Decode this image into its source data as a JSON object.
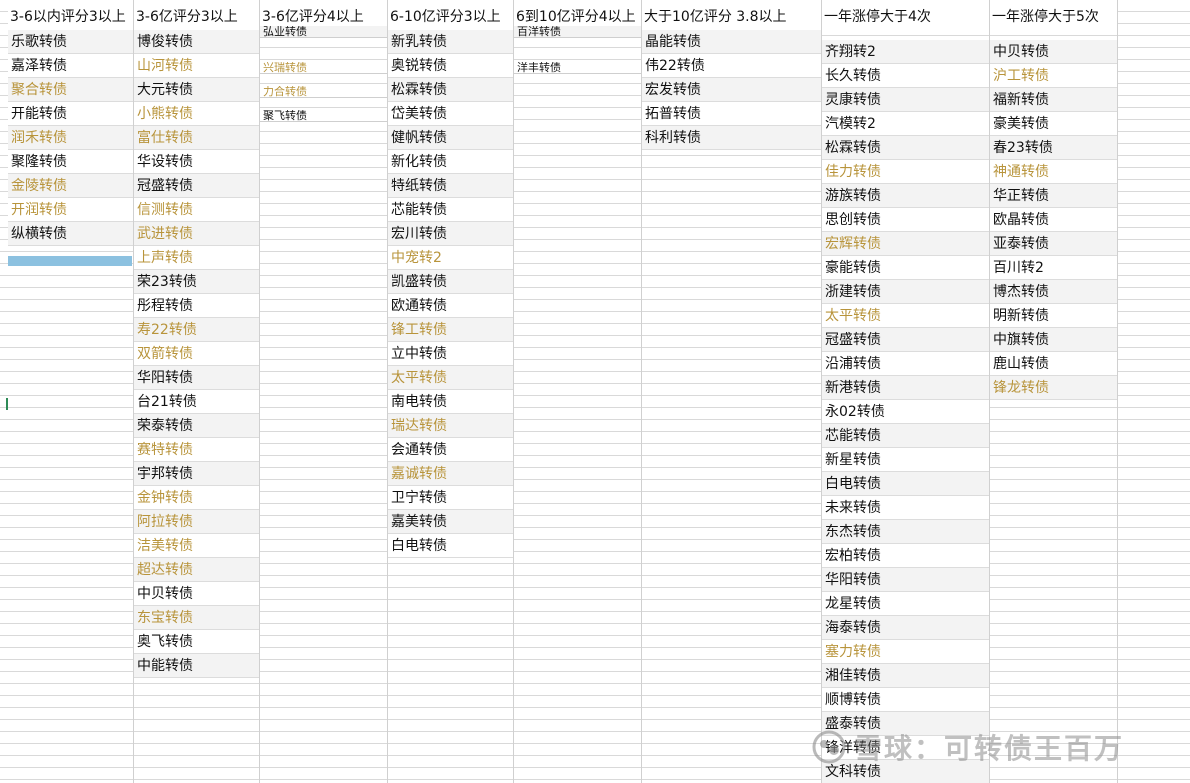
{
  "columns": [
    {
      "header": "3-6以内评分3以上",
      "rows": [
        {
          "text": "乐歌转债",
          "color": "black"
        },
        {
          "text": "嘉泽转债",
          "color": "black"
        },
        {
          "text": "聚合转债",
          "color": "gold"
        },
        {
          "text": "开能转债",
          "color": "black"
        },
        {
          "text": "润禾转债",
          "color": "gold"
        },
        {
          "text": "聚隆转债",
          "color": "black"
        },
        {
          "text": "金陵转债",
          "color": "gold"
        },
        {
          "text": "开润转债",
          "color": "gold"
        },
        {
          "text": "纵横转债",
          "color": "black"
        }
      ]
    },
    {
      "header": "3-6亿评分3以上",
      "rows": [
        {
          "text": "博俊转债",
          "color": "black"
        },
        {
          "text": "山河转债",
          "color": "gold"
        },
        {
          "text": "大元转债",
          "color": "black"
        },
        {
          "text": "小熊转债",
          "color": "gold"
        },
        {
          "text": "富仕转债",
          "color": "gold"
        },
        {
          "text": "华设转债",
          "color": "black"
        },
        {
          "text": "冠盛转债",
          "color": "black"
        },
        {
          "text": "信测转债",
          "color": "gold"
        },
        {
          "text": "武进转债",
          "color": "gold"
        },
        {
          "text": "上声转债",
          "color": "gold"
        },
        {
          "text": "荣23转债",
          "color": "black"
        },
        {
          "text": "彤程转债",
          "color": "black"
        },
        {
          "text": "寿22转债",
          "color": "gold"
        },
        {
          "text": "双箭转债",
          "color": "gold"
        },
        {
          "text": "华阳转债",
          "color": "black"
        },
        {
          "text": "台21转债",
          "color": "black"
        },
        {
          "text": "荣泰转债",
          "color": "black"
        },
        {
          "text": "赛特转债",
          "color": "gold"
        },
        {
          "text": "宇邦转债",
          "color": "black"
        },
        {
          "text": "金钟转债",
          "color": "gold"
        },
        {
          "text": "阿拉转债",
          "color": "gold"
        },
        {
          "text": "洁美转债",
          "color": "gold"
        },
        {
          "text": "超达转债",
          "color": "gold"
        },
        {
          "text": "中贝转债",
          "color": "black"
        },
        {
          "text": "东宝转债",
          "color": "gold"
        },
        {
          "text": "奥飞转债",
          "color": "black"
        },
        {
          "text": "中能转债",
          "color": "black"
        }
      ]
    },
    {
      "header": "3-6亿评分4以上",
      "small_rows": [
        {
          "text": "弘业转债",
          "color": "black"
        },
        {
          "text": "",
          "color": "black"
        },
        {
          "text": "",
          "color": "black"
        },
        {
          "text": "兴瑞转债",
          "color": "gold"
        },
        {
          "text": "",
          "color": "black"
        },
        {
          "text": "力合转债",
          "color": "gold"
        },
        {
          "text": "",
          "color": "black"
        },
        {
          "text": "聚飞转债",
          "color": "black"
        }
      ]
    },
    {
      "header": "6-10亿评分3以上",
      "rows": [
        {
          "text": "新乳转债",
          "color": "black"
        },
        {
          "text": "奥锐转债",
          "color": "black"
        },
        {
          "text": "松霖转债",
          "color": "black"
        },
        {
          "text": "岱美转债",
          "color": "black"
        },
        {
          "text": "健帆转债",
          "color": "black"
        },
        {
          "text": "新化转债",
          "color": "black"
        },
        {
          "text": "特纸转债",
          "color": "black"
        },
        {
          "text": "芯能转债",
          "color": "black"
        },
        {
          "text": "宏川转债",
          "color": "black"
        },
        {
          "text": "中宠转2",
          "color": "gold"
        },
        {
          "text": "凯盛转债",
          "color": "black"
        },
        {
          "text": "欧通转债",
          "color": "black"
        },
        {
          "text": "锋工转债",
          "color": "gold"
        },
        {
          "text": "立中转债",
          "color": "black"
        },
        {
          "text": "太平转债",
          "color": "gold"
        },
        {
          "text": "南电转债",
          "color": "black"
        },
        {
          "text": "瑞达转债",
          "color": "gold"
        },
        {
          "text": "会通转债",
          "color": "black"
        },
        {
          "text": "嘉诚转债",
          "color": "gold"
        },
        {
          "text": "卫宁转债",
          "color": "black"
        },
        {
          "text": "嘉美转债",
          "color": "black"
        },
        {
          "text": "白电转债",
          "color": "black"
        }
      ]
    },
    {
      "header": "6到10亿评分4以上",
      "small_rows": [
        {
          "text": "百洋转债",
          "color": "black"
        },
        {
          "text": "",
          "color": "black"
        },
        {
          "text": "",
          "color": "black"
        },
        {
          "text": "洋丰转债",
          "color": "black"
        }
      ]
    },
    {
      "header": "大于10亿评分 3.8以上",
      "rows": [
        {
          "text": "晶能转债",
          "color": "black"
        },
        {
          "text": "伟22转债",
          "color": "black"
        },
        {
          "text": "宏发转债",
          "color": "black"
        },
        {
          "text": "拓普转债",
          "color": "black"
        },
        {
          "text": "科利转债",
          "color": "black"
        }
      ]
    },
    {
      "header": "一年涨停大于4次",
      "rows": [
        {
          "text": "齐翔转2",
          "color": "black"
        },
        {
          "text": "长久转债",
          "color": "black"
        },
        {
          "text": "灵康转债",
          "color": "black"
        },
        {
          "text": "汽模转2",
          "color": "black"
        },
        {
          "text": "松霖转债",
          "color": "black"
        },
        {
          "text": "佳力转债",
          "color": "gold"
        },
        {
          "text": "游族转债",
          "color": "black"
        },
        {
          "text": "思创转债",
          "color": "black"
        },
        {
          "text": "宏辉转债",
          "color": "gold"
        },
        {
          "text": "豪能转债",
          "color": "black"
        },
        {
          "text": "浙建转债",
          "color": "black"
        },
        {
          "text": "太平转债",
          "color": "gold"
        },
        {
          "text": "冠盛转债",
          "color": "black"
        },
        {
          "text": "沿浦转债",
          "color": "black"
        },
        {
          "text": "新港转债",
          "color": "black"
        },
        {
          "text": "永02转债",
          "color": "black"
        },
        {
          "text": "芯能转债",
          "color": "black"
        },
        {
          "text": "新星转债",
          "color": "black"
        },
        {
          "text": "白电转债",
          "color": "black"
        },
        {
          "text": "未来转债",
          "color": "black"
        },
        {
          "text": "东杰转债",
          "color": "black"
        },
        {
          "text": "宏柏转债",
          "color": "black"
        },
        {
          "text": "华阳转债",
          "color": "black"
        },
        {
          "text": "龙星转债",
          "color": "black"
        },
        {
          "text": "海泰转债",
          "color": "black"
        },
        {
          "text": "塞力转债",
          "color": "gold"
        },
        {
          "text": "湘佳转债",
          "color": "black"
        },
        {
          "text": "顺博转债",
          "color": "black"
        },
        {
          "text": "盛泰转债",
          "color": "black"
        },
        {
          "text": "锋洋转债",
          "color": "black"
        },
        {
          "text": "文科转债",
          "color": "black"
        }
      ]
    },
    {
      "header": "一年涨停大于5次",
      "rows": [
        {
          "text": "中贝转债",
          "color": "black"
        },
        {
          "text": "沪工转债",
          "color": "gold"
        },
        {
          "text": "福新转债",
          "color": "black"
        },
        {
          "text": "豪美转债",
          "color": "black"
        },
        {
          "text": "春23转债",
          "color": "black"
        },
        {
          "text": "神通转债",
          "color": "gold"
        },
        {
          "text": "华正转债",
          "color": "black"
        },
        {
          "text": "欧晶转债",
          "color": "black"
        },
        {
          "text": "亚泰转债",
          "color": "black"
        },
        {
          "text": "百川转2",
          "color": "black"
        },
        {
          "text": "博杰转债",
          "color": "black"
        },
        {
          "text": "明新转债",
          "color": "black"
        },
        {
          "text": "中旗转债",
          "color": "black"
        },
        {
          "text": "鹿山转债",
          "color": "black"
        },
        {
          "text": "锋龙转债",
          "color": "gold"
        }
      ]
    }
  ],
  "watermark": {
    "text": "雪球：可转债王百万",
    "logo_icon": "snowball-logo-icon"
  },
  "colors": {
    "gold_text": "#b8943b",
    "black_text": "#111111",
    "selection_bar": "#8cc1e0"
  }
}
